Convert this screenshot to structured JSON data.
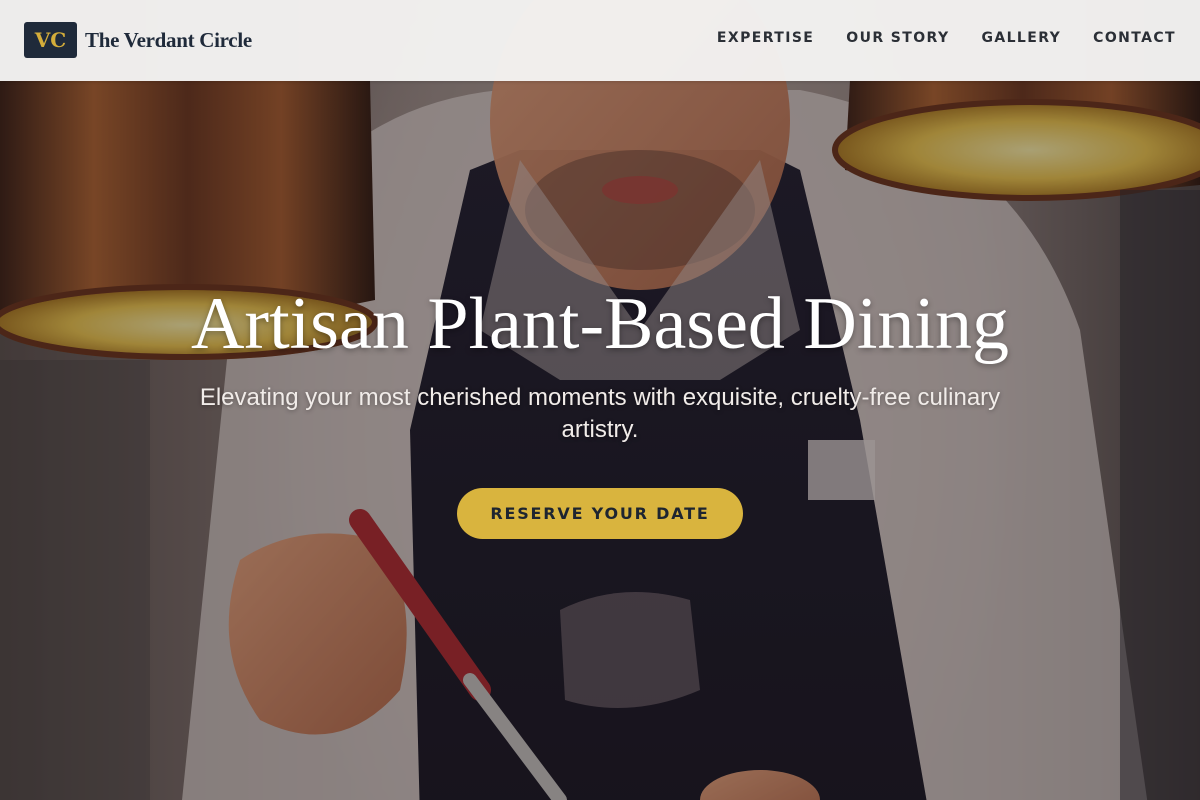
{
  "brand": {
    "logo_text": "VC",
    "name": "The Verdant Circle"
  },
  "nav": {
    "items": [
      {
        "label": "EXPERTISE"
      },
      {
        "label": "OUR STORY"
      },
      {
        "label": "GALLERY"
      },
      {
        "label": "CONTACT"
      }
    ]
  },
  "hero": {
    "title": "Artisan Plant-Based Dining",
    "subtitle": "Elevating your most cherished moments with exquisite, cruelty-free culinary artistry.",
    "cta_label": "RESERVE YOUR DATE",
    "background_image": "chef-plating-photo"
  },
  "colors": {
    "accent": "#d9b43e",
    "brand_dark": "#1f2a3a",
    "header_bg": "#f5f4f3"
  }
}
